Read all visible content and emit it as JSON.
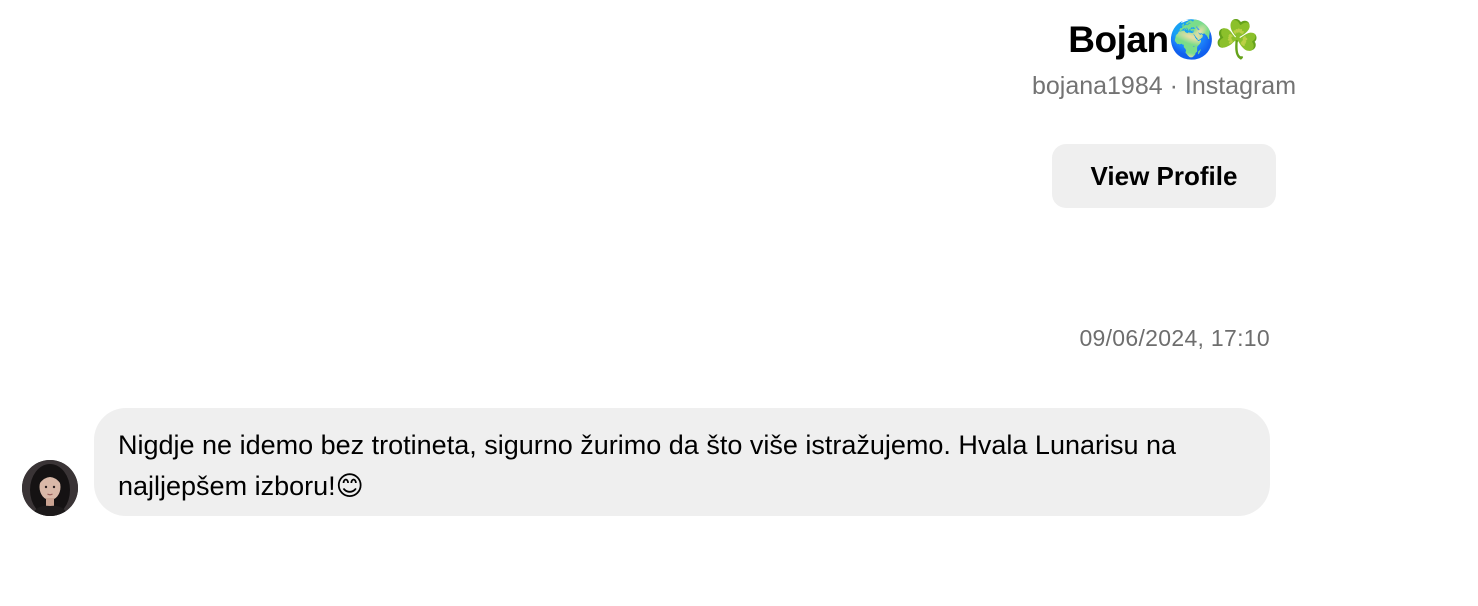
{
  "profile": {
    "name": "Bojan🌍☘️",
    "username": "bojana1984",
    "separator": " · ",
    "platform": "Instagram",
    "view_profile_label": "View Profile"
  },
  "conversation": {
    "timestamp": "09/06/2024, 17:10",
    "messages": [
      {
        "sender": "incoming",
        "avatar_icon": "user-avatar",
        "text": "Nigdje ne idemo bez trotineta, sigurno žurimo da što više istražujemo. Hvala Lunarisu na najljepšem izboru!😊"
      }
    ]
  }
}
